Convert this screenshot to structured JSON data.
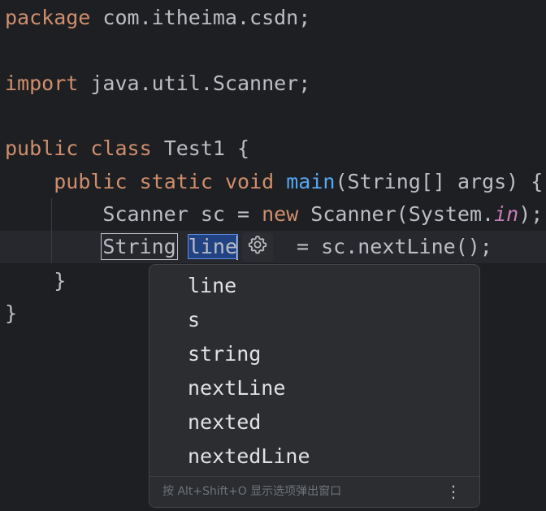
{
  "code": {
    "package_kw": "package",
    "package_name": " com.itheima.csdn;",
    "import_kw": "import",
    "import_name": " java.util.Scanner;",
    "class_mod": "public",
    "class_kw": "class",
    "class_name": " Test1 {",
    "main_mod": "public",
    "main_static": "static",
    "main_void": "void",
    "main_name": "main",
    "main_params": "(String[] args) {",
    "scanner_decl": "Scanner sc = ",
    "new_kw": "new",
    "scanner_ctor": " Scanner(System.",
    "in_field": "in",
    "scanner_end": ");",
    "string_type": "String",
    "var_name": "line",
    "assign_rest": "= sc.nextLine();",
    "close_inner": "}",
    "close_outer": "}"
  },
  "popup": {
    "items": [
      "line",
      "s",
      "string",
      "nextLine",
      "nexted",
      "nextedLine"
    ],
    "footer_hint": "按 Alt+Shift+O 显示选项弹出窗口",
    "menu_glyph": "⋮"
  }
}
